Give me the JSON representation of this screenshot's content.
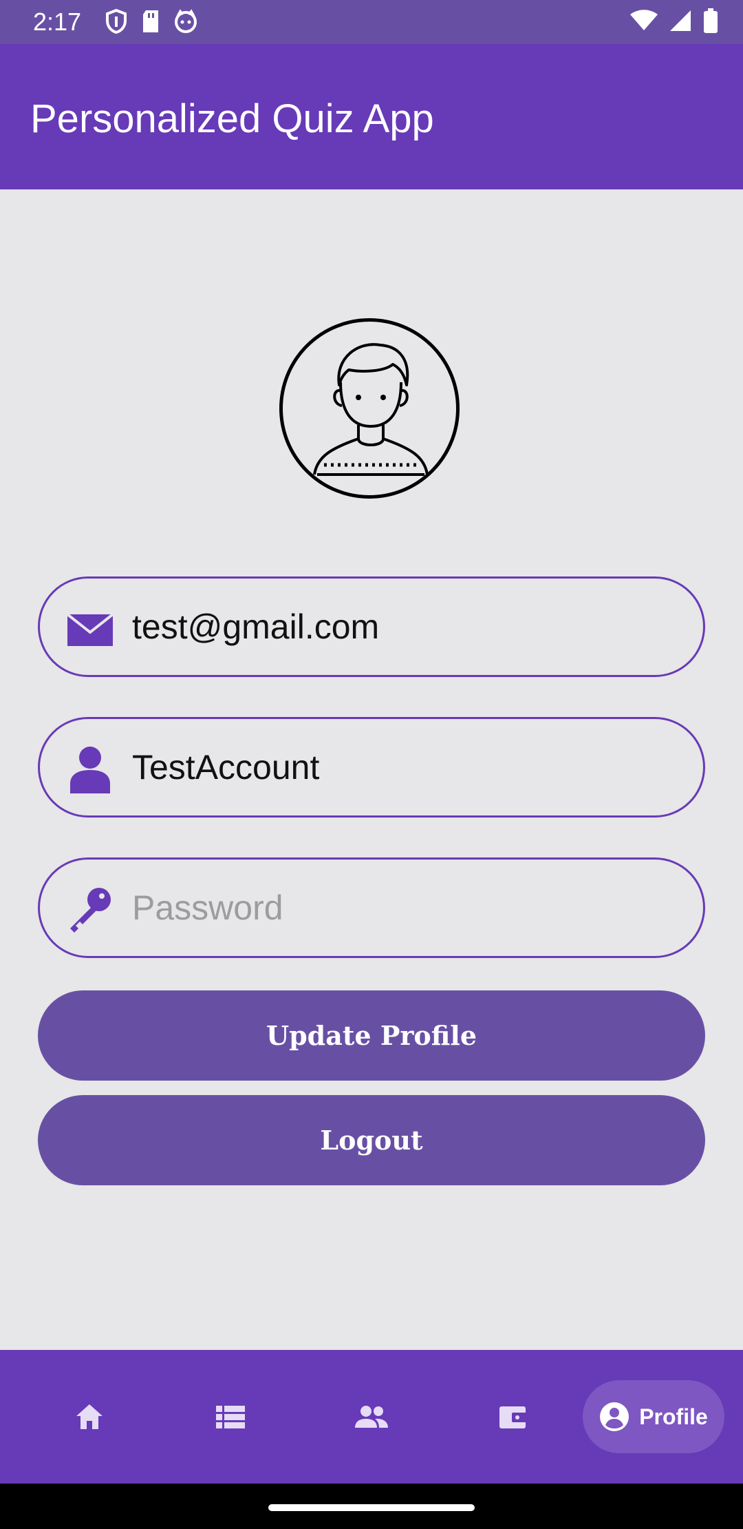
{
  "status_bar": {
    "time": "2:17"
  },
  "app_bar": {
    "title": "Personalized Quiz App"
  },
  "profile": {
    "email": "test@gmail.com",
    "username": "TestAccount",
    "password_placeholder": "Password"
  },
  "buttons": {
    "update_label": "Update Profile",
    "logout_label": "Logout"
  },
  "bottom_nav": {
    "items": [
      {
        "icon": "home-icon"
      },
      {
        "icon": "list-icon"
      },
      {
        "icon": "group-icon"
      },
      {
        "icon": "wallet-icon"
      },
      {
        "icon": "account-circle-icon",
        "label": "Profile",
        "active": true
      }
    ]
  },
  "colors": {
    "primary": "#673ab7",
    "button": "#6750a4",
    "background": "#e7e6e8",
    "active_pill": "#7e57c2"
  }
}
